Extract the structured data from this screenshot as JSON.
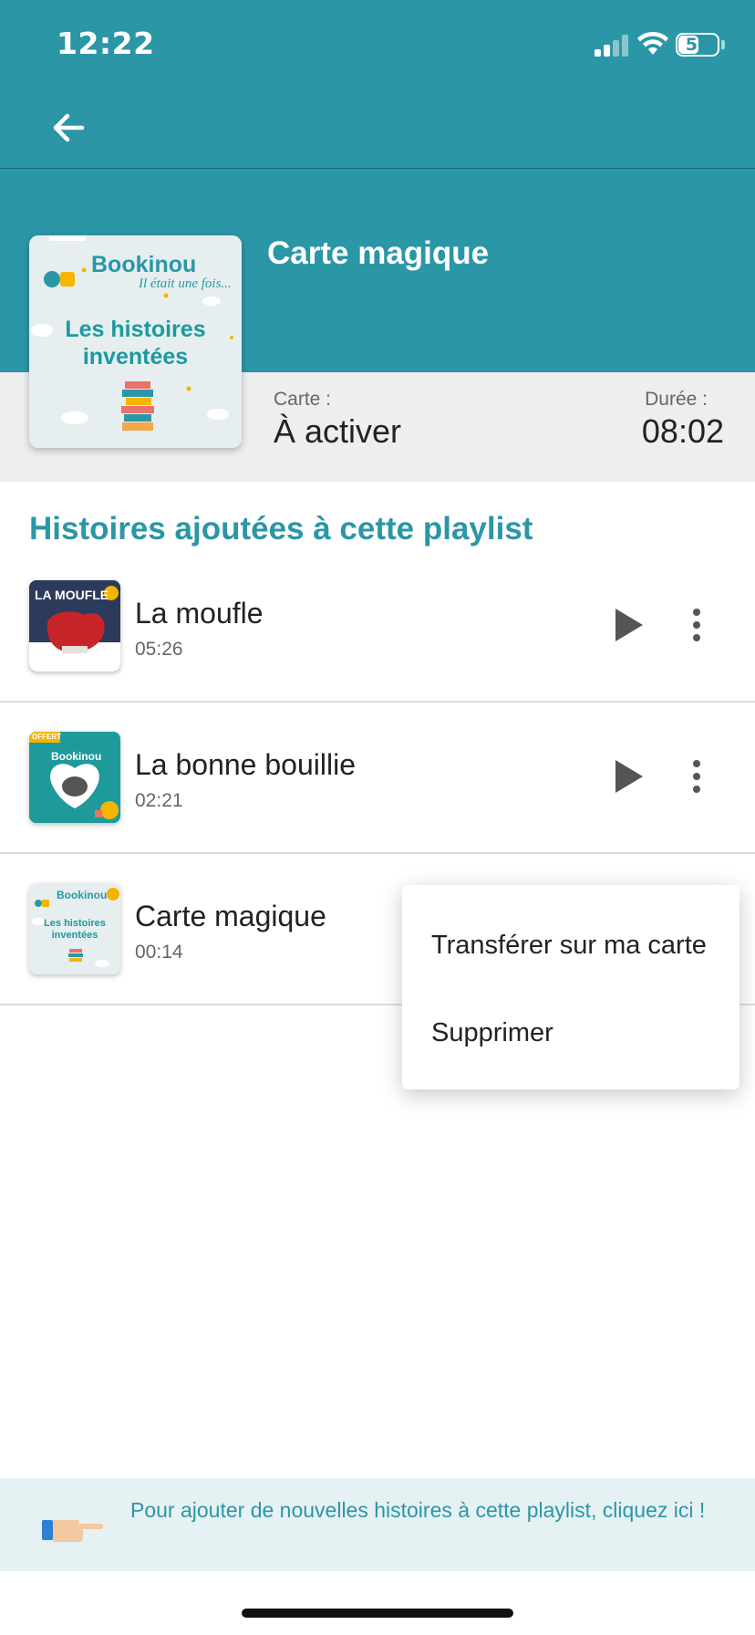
{
  "status_bar": {
    "time": "12:22",
    "battery": "50"
  },
  "header": {
    "title": "Carte magique"
  },
  "cover": {
    "brand": "Bookinou",
    "tagline": "Il était une fois...",
    "title": "Les histoires inventées"
  },
  "info": {
    "card_label": "Carte :",
    "card_value": "À activer",
    "duration_label": "Durée :",
    "duration_value": "08:02"
  },
  "section": {
    "title": "Histoires ajoutées à cette playlist"
  },
  "stories": [
    {
      "title": "La moufle",
      "duration": "05:26",
      "thumb_text": "LA MOUFLE"
    },
    {
      "title": "La bonne bouillie",
      "duration": "02:21",
      "thumb_badge": "OFFERT",
      "thumb_brand": "Bookinou"
    },
    {
      "title": "Carte magique",
      "duration": "00:14",
      "thumb_brand": "Bookinou",
      "thumb_title": "Les histoires inventées"
    }
  ],
  "context_menu": {
    "items": [
      "Transférer sur ma carte",
      "Supprimer"
    ]
  },
  "footer": {
    "text": "Pour ajouter de nouvelles histoires à cette playlist, cliquez ici !"
  },
  "colors": {
    "teal": "#2b96a6",
    "band": "#eeeeee",
    "footer_bg": "#e6f1f3"
  }
}
